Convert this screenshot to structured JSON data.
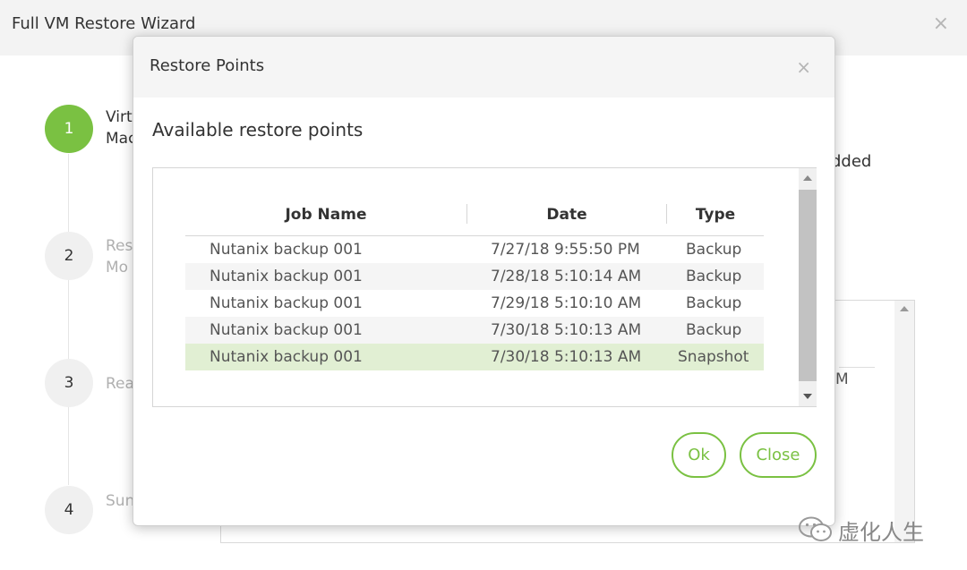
{
  "wizard": {
    "title": "Full VM Restore Wizard",
    "close_glyph": "×",
    "steps": [
      {
        "number": "1",
        "label": "Virt\nMac"
      },
      {
        "number": "2",
        "label": "Res\nMo"
      },
      {
        "number": "3",
        "label": "Rea"
      },
      {
        "number": "4",
        "label": "Sun"
      }
    ],
    "background_text_added": "dded",
    "background_text_m": "M"
  },
  "modal": {
    "title": "Restore Points",
    "close_glyph": "×",
    "subtitle": "Available restore points",
    "columns": [
      "Job Name",
      "Date",
      "Type"
    ],
    "rows": [
      {
        "job_name": "Nutanix backup 001",
        "date": "7/27/18 9:55:50 PM",
        "type": "Backup"
      },
      {
        "job_name": "Nutanix backup 001",
        "date": "7/28/18 5:10:14 AM",
        "type": "Backup"
      },
      {
        "job_name": "Nutanix backup 001",
        "date": "7/29/18 5:10:10 AM",
        "type": "Backup"
      },
      {
        "job_name": "Nutanix backup 001",
        "date": "7/30/18 5:10:13 AM",
        "type": "Backup"
      },
      {
        "job_name": "Nutanix backup 001",
        "date": "7/30/18 5:10:13 AM",
        "type": "Snapshot"
      }
    ],
    "selected_row_index": 4,
    "buttons": {
      "ok": "Ok",
      "close": "Close"
    }
  },
  "watermark": {
    "text": "虚化人生"
  },
  "colors": {
    "accent": "#7ac142",
    "selected_row": "#e1efd3",
    "alt_row": "#f5f5f5"
  }
}
